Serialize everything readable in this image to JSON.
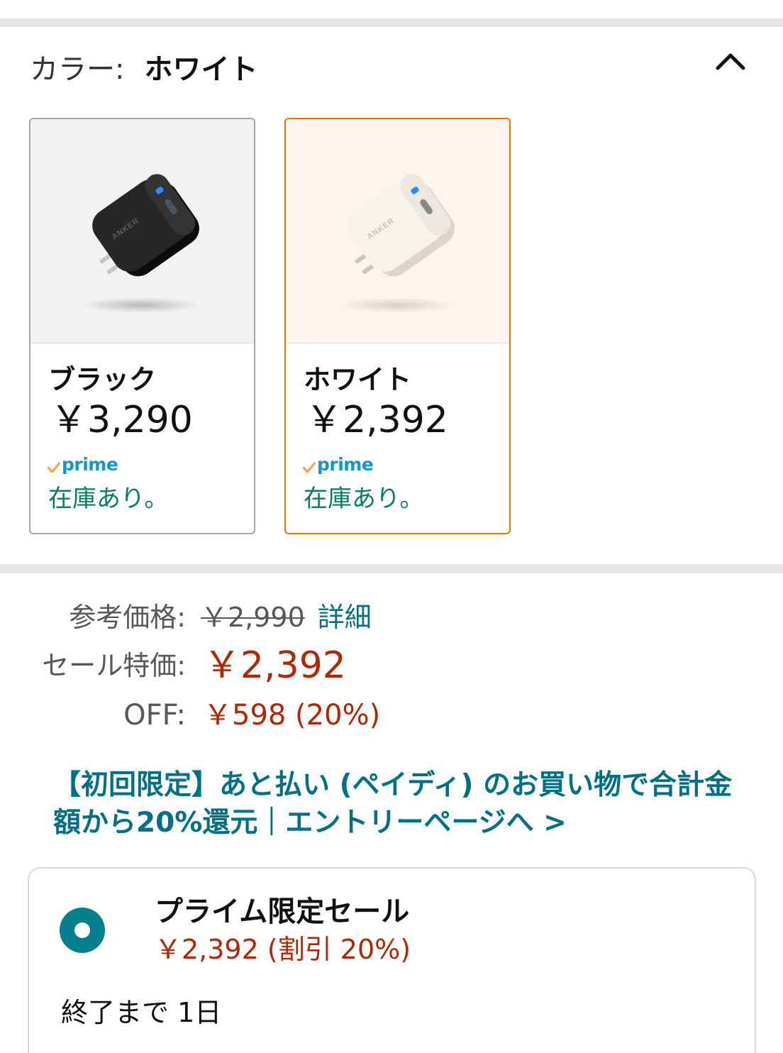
{
  "colors": {
    "text": "#0f1111",
    "muted": "#565959",
    "link": "#007185",
    "price_red": "#b12704",
    "in_stock_green": "#067d62",
    "selected_border": "#e77600",
    "unselected_border": "#a2a6ac",
    "prime_blue": "#1399c6",
    "prime_check": "#f3a847",
    "radio_selected": "#03808e",
    "divider": "#e3e6e6"
  },
  "icons": {
    "collapse": "chevron-up-icon",
    "prime": "prime-check-icon",
    "deal_radio": "radio-selected-icon"
  },
  "color_selector": {
    "label": "カラー:",
    "selected_name": "ホワイト",
    "options": [
      {
        "name": "ブラック",
        "price": "￥3,290",
        "prime_label": "prime",
        "stock": "在庫あり。",
        "selected": false,
        "brand_mark": "ANKER",
        "image_bg": "#f2f2f2",
        "product_body": "#262626",
        "product_shade": "#0c0c0c",
        "product_end": "#333333",
        "brand_mark_color": "#5c5c5c"
      },
      {
        "name": "ホワイト",
        "price": "￥2,392",
        "prime_label": "prime",
        "stock": "在庫あり。",
        "selected": true,
        "brand_mark": "ANKER",
        "image_bg": "#fbf5ee",
        "product_body": "#f6f2ec",
        "product_shade": "#dcd5cb",
        "product_end": "#ece7e0",
        "brand_mark_color": "#c8c0b5"
      }
    ]
  },
  "pricing": {
    "list_price_label": "参考価格:",
    "list_price": "￥2,990",
    "details_link": "詳細",
    "sale_label": "セール特価:",
    "sale_price": "￥2,392",
    "off_label": "OFF:",
    "off_value": "￥598 (20%)"
  },
  "promo": {
    "text": "【初回限定】あと払い (ペイディ) のお買い物で合計金額から20%還元｜エントリーページへ >"
  },
  "deal": {
    "selected": true,
    "title": "プライム限定セール",
    "price": "￥2,392 (割引 20%)",
    "ends": "終了まで 1日"
  }
}
